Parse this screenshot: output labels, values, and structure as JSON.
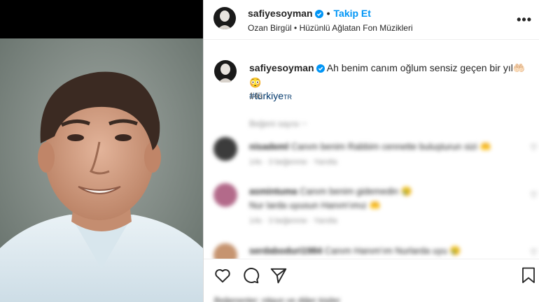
{
  "header": {
    "username": "safiyesoyman",
    "separator": "•",
    "follow_label": "Takip Et",
    "music": "Ozan Birgül • Hüzünlü Ağlatan Fon Müzikleri",
    "more": "•••"
  },
  "caption": {
    "username": "safiyesoyman",
    "text": "Ah benim canım oğlum sensiz geçen bir yıl🤲🏻 😳",
    "hashtag": "#türkiye",
    "hashtag_suffix": "TR",
    "time": "14s"
  },
  "comments": {
    "hidden_label": "Beğeni sayısı ~",
    "items": [
      {
        "user": "nisademl",
        "text": "Canım benim Rabbim cennette buluşturun sizi 🤲",
        "meta": "14s · 3 beğenme · Yanıtla"
      },
      {
        "user": "asmintuma",
        "text": "Canım benim gidemedin 😢",
        "text2": "Nur larda uyusun Hanım'ımız 🤲",
        "meta": "14s · 3 beğenme · Yanıtla"
      },
      {
        "user": "serdaboduri1984",
        "text": "Canım Hanım'ım Nurlarda uyu 😢",
        "meta": ""
      }
    ]
  },
  "footer": {
    "likes": "Beğenenler: nilgun ve diğer kişiler"
  },
  "colors": {
    "accent": "#0095f6",
    "hashtag": "#00376b",
    "verified": "#0095f6"
  }
}
